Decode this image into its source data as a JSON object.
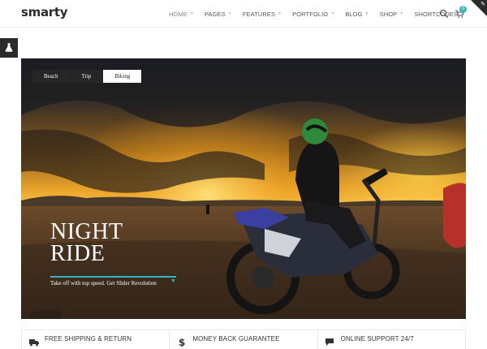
{
  "header": {
    "logo": "smarty",
    "nav": [
      {
        "label": "HOME",
        "active": true
      },
      {
        "label": "PAGES",
        "active": false
      },
      {
        "label": "FEATURES",
        "active": false
      },
      {
        "label": "PORTFOLIO",
        "active": false
      },
      {
        "label": "BLOG",
        "active": false
      },
      {
        "label": "SHOP",
        "active": false
      },
      {
        "label": "SHORTCODES",
        "active": false
      }
    ],
    "cart_count": "0"
  },
  "slider": {
    "tabs": [
      {
        "label": "Beach",
        "active": false
      },
      {
        "label": "Trip",
        "active": false
      },
      {
        "label": "Biking",
        "active": true
      }
    ],
    "title_line1": "NIGHT",
    "title_line2": "RIDE",
    "subtitle": "Take off with top speed. Get Slider Revolution"
  },
  "features": [
    {
      "label": "FREE SHIPPING & RETURN",
      "icon": "truck-icon"
    },
    {
      "label": "MONEY BACK GUARANTEE",
      "icon": "dollar-icon"
    },
    {
      "label": "ONLINE SUPPORT 24/7",
      "icon": "chat-icon"
    }
  ],
  "colors": {
    "accent": "#34b6c8",
    "dark": "#2b2b2b"
  }
}
